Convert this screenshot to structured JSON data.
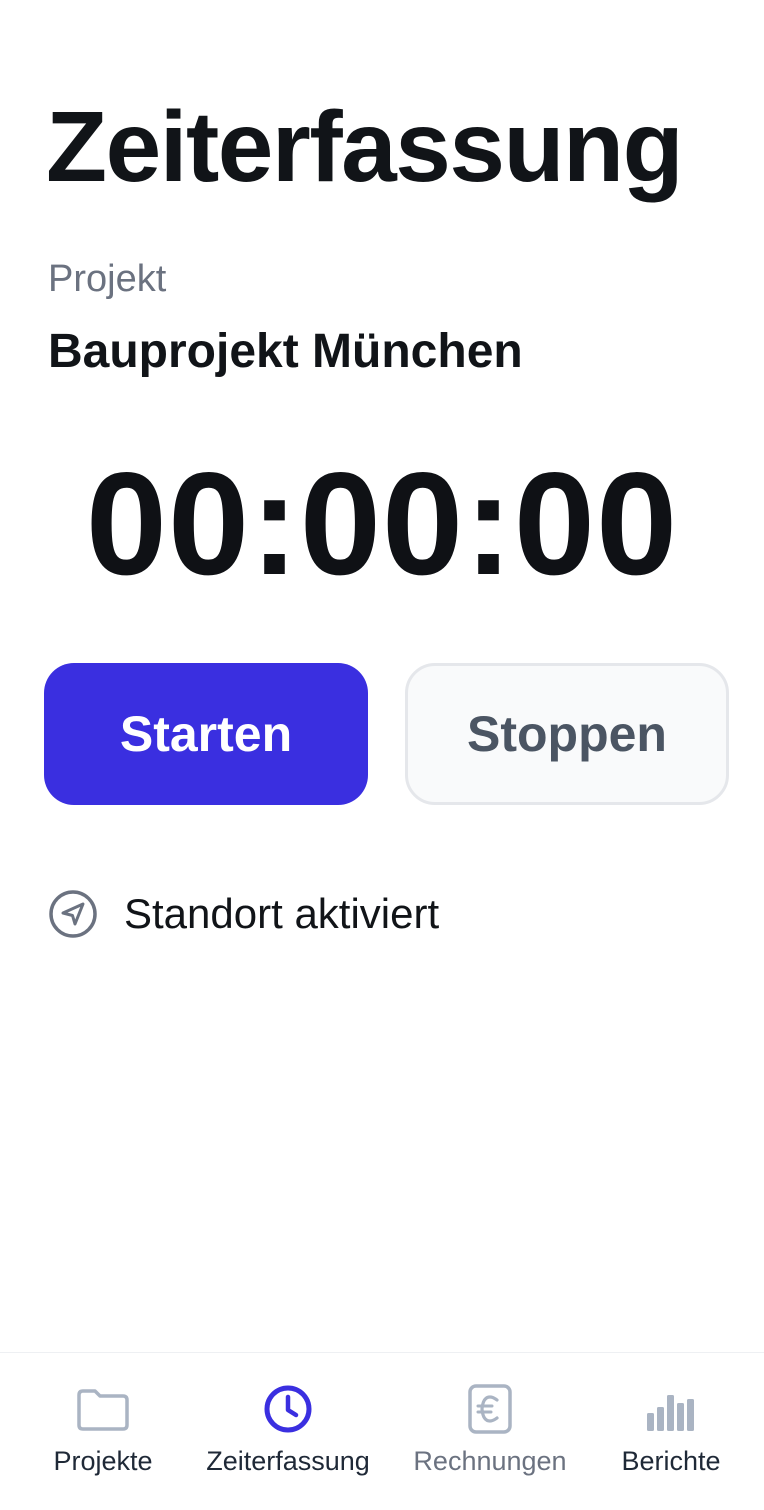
{
  "header": {
    "title": "Zeiterfassung"
  },
  "project": {
    "label": "Projekt",
    "name": "Bauprojekt München"
  },
  "timer": {
    "display": "00:00:00"
  },
  "actions": {
    "start_label": "Starten",
    "stop_label": "Stoppen"
  },
  "location": {
    "status": "Standort aktiviert",
    "icon": "location-arrow-icon"
  },
  "bottom_nav": {
    "items": [
      {
        "label": "Projekte",
        "icon": "folder-icon",
        "active": false
      },
      {
        "label": "Zeiterfassung",
        "icon": "clock-icon",
        "active": true
      },
      {
        "label": "Rechnungen",
        "icon": "euro-document-icon",
        "active": false
      },
      {
        "label": "Berichte",
        "icon": "bar-chart-icon",
        "active": false
      }
    ]
  },
  "colors": {
    "accent": "#3a2fe0",
    "text_primary": "#111418",
    "text_secondary": "#6b7280",
    "icon_inactive": "#aab4c3"
  }
}
